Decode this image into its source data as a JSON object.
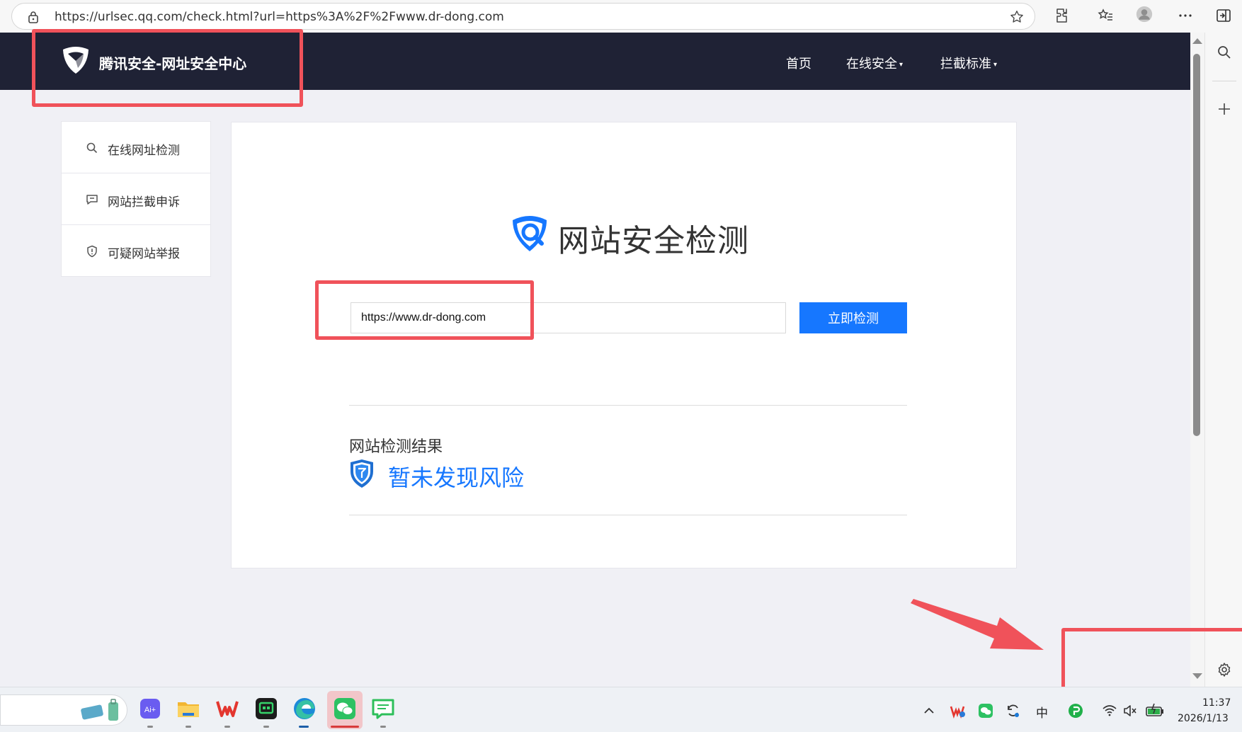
{
  "browser": {
    "url": "https://urlsec.qq.com/check.html?url=https%3A%2F%2Fwww.dr-dong.com"
  },
  "site": {
    "title": "腾讯安全-网址安全中心",
    "nav": [
      {
        "label": "首页"
      },
      {
        "label": "在线安全",
        "caret": "▾"
      },
      {
        "label": "拦截标准",
        "caret": "▾"
      }
    ]
  },
  "sidebar": {
    "items": [
      {
        "label": "在线网址检测",
        "icon": "search-icon"
      },
      {
        "label": "网站拦截申诉",
        "icon": "comment-icon"
      },
      {
        "label": "可疑网站举报",
        "icon": "shield-alert-icon"
      }
    ]
  },
  "main": {
    "heading": "网站安全检测",
    "input_value": "https://www.dr-dong.com",
    "check_button": "立即检测",
    "result_label": "网站检测结果",
    "result_text": "暂未发现风险"
  },
  "taskbar": {
    "ime": "中",
    "time": "11:37",
    "date": "2026/1/13"
  },
  "colors": {
    "header_bg": "#1f2235",
    "accent": "#1677ff",
    "annotation": "#f0525a"
  }
}
